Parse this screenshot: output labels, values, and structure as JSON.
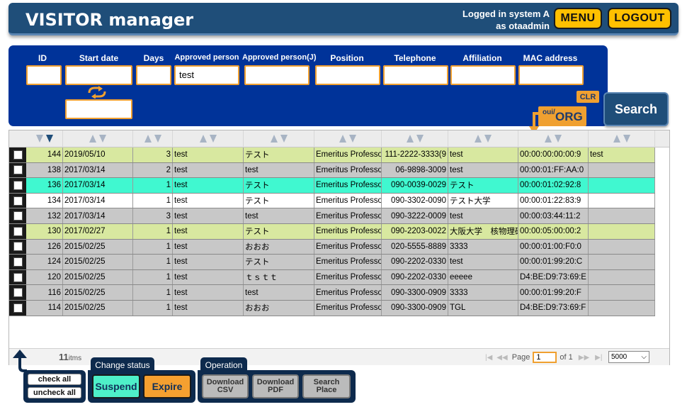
{
  "header": {
    "title": "VISITOR manager",
    "login_line1": "Logged in system A",
    "login_line2": "as otaadmin",
    "menu_label": "MENU",
    "logout_label": "LOGOUT"
  },
  "filters": {
    "labels": [
      "ID",
      "Start date",
      "Days",
      "Approved person",
      "Approved person(J)",
      "Position",
      "Telephone",
      "Affiliation",
      "MAC address"
    ],
    "approved_person_value": "test",
    "search_label": "Search",
    "clr_label": "CLR",
    "oui_label": "oui/",
    "org_label": "ORG"
  },
  "table": {
    "rows": [
      {
        "id": "144",
        "date": "2019/05/10",
        "days": "3",
        "ap": "test",
        "apj": "テスト",
        "pos": "Emeritus Professor",
        "tel": "111-2222-3333(9",
        "aff": "test",
        "mac": "00:00:00:00:00:9",
        "extra": "test",
        "color": "#d8e8a0"
      },
      {
        "id": "138",
        "date": "2017/03/14",
        "days": "2",
        "ap": "test",
        "apj": "test",
        "pos": "Emeritus Professor",
        "tel": "06-9898-3009",
        "aff": "test",
        "mac": "00:00:01:FF:AA:0",
        "extra": "",
        "color": "#c8c8c8"
      },
      {
        "id": "136",
        "date": "2017/03/14",
        "days": "1",
        "ap": "test",
        "apj": "テスト",
        "pos": "Emeritus Professor",
        "tel": "090-0039-0029",
        "aff": "テスト",
        "mac": "00:00:01:02:92:8",
        "extra": "",
        "color": "#40f8d0"
      },
      {
        "id": "134",
        "date": "2017/03/14",
        "days": "1",
        "ap": "test",
        "apj": "テスト",
        "pos": "Emeritus Professor",
        "tel": "090-3302-0090",
        "aff": "テスト大学",
        "mac": "00:00:01:22:83:9",
        "extra": "",
        "color": "#ffffff"
      },
      {
        "id": "132",
        "date": "2017/03/14",
        "days": "3",
        "ap": "test",
        "apj": "test",
        "pos": "Emeritus Professor",
        "tel": "090-3222-0009",
        "aff": "test",
        "mac": "00:00:03:44:11:2",
        "extra": "",
        "color": "#c8c8c8"
      },
      {
        "id": "130",
        "date": "2017/02/27",
        "days": "1",
        "ap": "test",
        "apj": "テスト",
        "pos": "Emeritus Professor",
        "tel": "090-2203-0022",
        "aff": "大阪大学　核物理研究",
        "mac": "00:00:05:00:00:2",
        "extra": "",
        "color": "#d8e8a0"
      },
      {
        "id": "126",
        "date": "2015/02/25",
        "days": "1",
        "ap": "test",
        "apj": "おおお",
        "pos": "Emeritus Professor",
        "tel": "020-5555-8889",
        "aff": "3333",
        "mac": "00:00:01:00:F0:0",
        "extra": "",
        "color": "#c8c8c8"
      },
      {
        "id": "124",
        "date": "2015/02/25",
        "days": "1",
        "ap": "test",
        "apj": "テスト",
        "pos": "Emeritus Professor",
        "tel": "090-2202-0330",
        "aff": "test",
        "mac": "00:00:01:99:20:C",
        "extra": "",
        "color": "#c8c8c8"
      },
      {
        "id": "120",
        "date": "2015/02/25",
        "days": "1",
        "ap": "test",
        "apj": "ｔｓｔｔ",
        "pos": "Emeritus Professor",
        "tel": "090-2202-0330",
        "aff": "eeeee",
        "mac": "D4:BE:D9:73:69:E",
        "extra": "",
        "color": "#c8c8c8"
      },
      {
        "id": "116",
        "date": "2015/02/25",
        "days": "1",
        "ap": "test",
        "apj": "test",
        "pos": "Emeritus Professor",
        "tel": "090-3300-0909",
        "aff": "3333",
        "mac": "00:00:01:99:20:F",
        "extra": "",
        "color": "#c8c8c8"
      },
      {
        "id": "114",
        "date": "2015/02/25",
        "days": "1",
        "ap": "test",
        "apj": "おおお",
        "pos": "Emeritus Professor",
        "tel": "090-3300-0909",
        "aff": "TGL",
        "mac": "D4:BE:D9:73:69:F",
        "extra": "",
        "color": "#c8c8c8"
      }
    ]
  },
  "footer": {
    "count_value": "11",
    "count_unit": "itms",
    "page_label": "Page",
    "page_value": "1",
    "of_label": "of 1",
    "page_size": "5000"
  },
  "bottom": {
    "check_all": "check all",
    "uncheck_all": "uncheck all",
    "change_status_label": "Change status",
    "suspend_label": "Suspend",
    "expire_label": "Expire",
    "operation_label": "Operation",
    "download_csv": "Download\nCSV",
    "download_pdf": "Download\nPDF",
    "search_place": "Search\nPlace"
  }
}
